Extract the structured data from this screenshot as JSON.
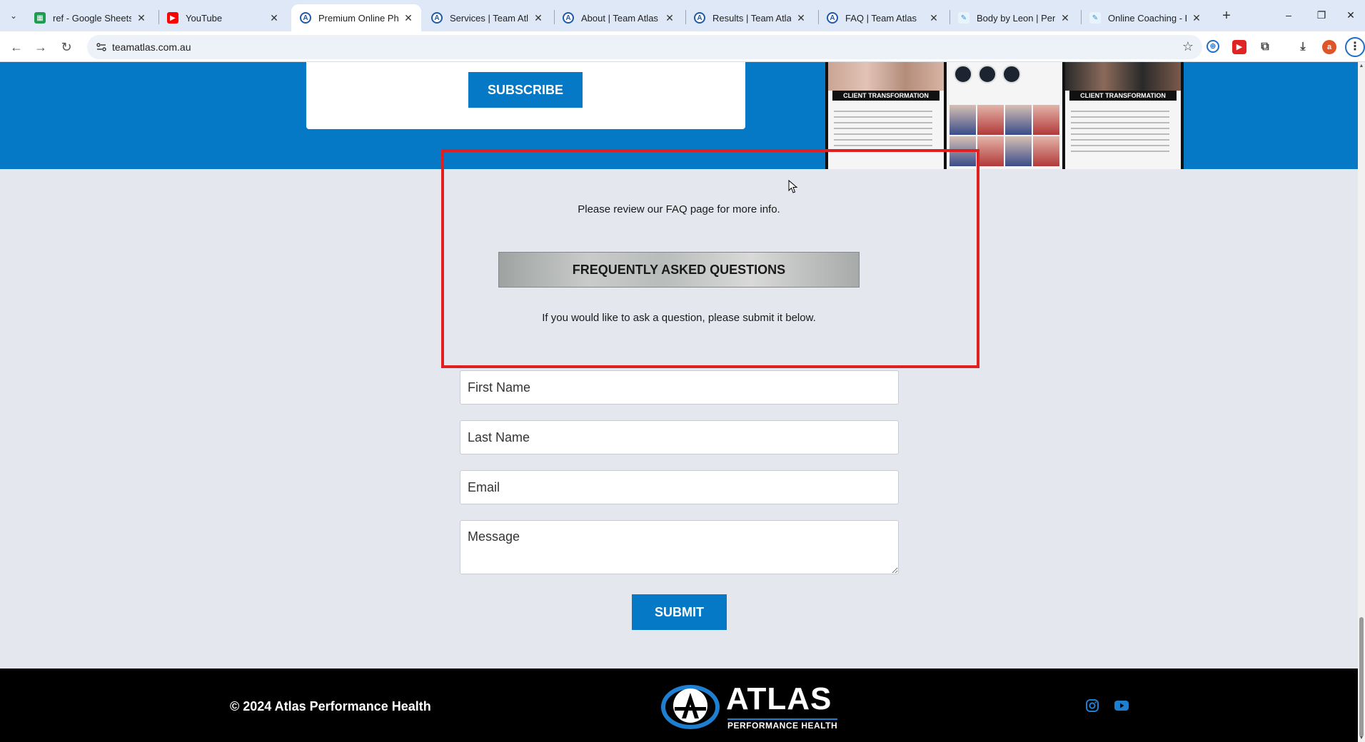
{
  "browser": {
    "tabs": [
      {
        "title": "ref - Google Sheets",
        "icon": "sheets-icon",
        "active": false
      },
      {
        "title": "YouTube",
        "icon": "youtube-icon",
        "active": false
      },
      {
        "title": "Premium Online Phys",
        "icon": "atlas-icon",
        "active": true
      },
      {
        "title": "Services | Team Atlas",
        "icon": "atlas-icon",
        "active": false
      },
      {
        "title": "About | Team Atlas",
        "icon": "atlas-icon",
        "active": false
      },
      {
        "title": "Results | Team Atlas",
        "icon": "atlas-icon",
        "active": false
      },
      {
        "title": "FAQ | Team Atlas",
        "icon": "atlas-icon",
        "active": false
      },
      {
        "title": "Body by Leon | Perso",
        "icon": "feather-icon",
        "active": false
      },
      {
        "title": "Online Coaching - Bo",
        "icon": "feather-icon",
        "active": false
      }
    ],
    "url": "teamatlas.com.au",
    "profile_initial": "a"
  },
  "subscribe": {
    "button_label": "SUBSCRIBE"
  },
  "instagram": {
    "tag_1": "CLIENT TRANSFORMATION",
    "tag_3": "CLIENT TRANSFORMATION"
  },
  "faq": {
    "note": "Please review our FAQ page for more info.",
    "button_label": "FREQUENTLY ASKED QUESTIONS",
    "ask_note": "If you would like to ask a question, please submit it below."
  },
  "form": {
    "first_name_placeholder": "First Name",
    "last_name_placeholder": "Last Name",
    "email_placeholder": "Email",
    "message_placeholder": "Message",
    "submit_label": "SUBMIT"
  },
  "footer": {
    "copyright": "© 2024 Atlas Performance Health",
    "logo_word": "ATLAS",
    "logo_sub": "PERFORMANCE HEALTH"
  },
  "colors": {
    "brand_blue": "#0578c6",
    "highlight_red": "#e02020",
    "page_bg": "#e4e7ed"
  }
}
